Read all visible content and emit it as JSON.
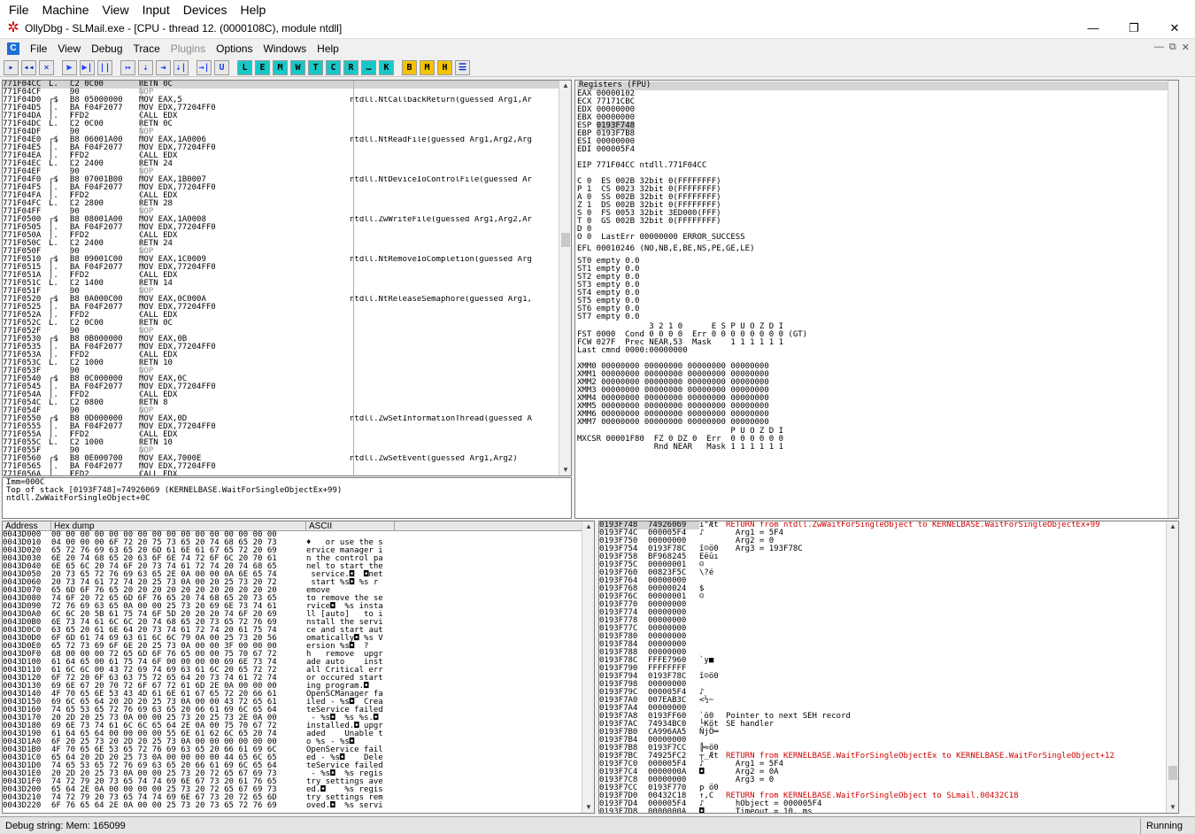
{
  "host_menu": [
    "File",
    "Machine",
    "View",
    "Input",
    "Devices",
    "Help"
  ],
  "window": {
    "title": "OllyDbg - SLMail.exe - [CPU - thread 12. (0000108C), module ntdll]",
    "minimize": "—",
    "restore": "❐",
    "close": "✕"
  },
  "menu": [
    "File",
    "View",
    "Debug",
    "Trace",
    "Plugins",
    "Options",
    "Windows",
    "Help"
  ],
  "menu_disabled": [
    "Plugins"
  ],
  "toolbar": {
    "control": [
      "▸",
      "◂◂",
      "✕",
      "▶",
      "▶|",
      "||",
      "↦",
      "⇣",
      "⇥",
      "⇣|",
      "→|",
      "U"
    ],
    "letters": [
      "L",
      "E",
      "M",
      "W",
      "T",
      "C",
      "R",
      "…",
      "K"
    ],
    "extra": [
      "B",
      "M",
      "H",
      "☰"
    ]
  },
  "disasm": [
    {
      "addr": "771F04CC",
      "br": "L.",
      "hex": "C2 0C00",
      "asm": "RETN 0C",
      "cmt": "",
      "sel": true
    },
    {
      "addr": "771F04CF",
      "br": "",
      "hex": "90",
      "asm": "NOP",
      "cmt": ""
    },
    {
      "addr": "771F04D0",
      "br": "┌$",
      "hex": "B8 05000000",
      "asm": "MOV EAX,5",
      "cmt": "ntdll.NtCallbackReturn(guessed Arg1,Ar"
    },
    {
      "addr": "771F04D5",
      "br": "│.",
      "hex": "BA F04F2077",
      "asm": "MOV EDX,77204FF0",
      "cmt": ""
    },
    {
      "addr": "771F04DA",
      "br": "│.",
      "hex": "FFD2",
      "asm": "CALL EDX",
      "cmt": ""
    },
    {
      "addr": "771F04DC",
      "br": "L.",
      "hex": "C2 0C00",
      "asm": "RETN 0C",
      "cmt": ""
    },
    {
      "addr": "771F04DF",
      "br": "",
      "hex": "90",
      "asm": "NOP",
      "cmt": ""
    },
    {
      "addr": "771F04E0",
      "br": "┌$",
      "hex": "B8 06001A00",
      "asm": "MOV EAX,1A0006",
      "cmt": "ntdll.NtReadFile(guessed Arg1,Arg2,Arg"
    },
    {
      "addr": "771F04E5",
      "br": "│.",
      "hex": "BA F04F2077",
      "asm": "MOV EDX,77204FF0",
      "cmt": ""
    },
    {
      "addr": "771F04EA",
      "br": "│.",
      "hex": "FFD2",
      "asm": "CALL EDX",
      "cmt": ""
    },
    {
      "addr": "771F04EC",
      "br": "L.",
      "hex": "C2 2400",
      "asm": "RETN 24",
      "cmt": ""
    },
    {
      "addr": "771F04EF",
      "br": "",
      "hex": "90",
      "asm": "NOP",
      "cmt": ""
    },
    {
      "addr": "771F04F0",
      "br": "┌$",
      "hex": "B8 07001B00",
      "asm": "MOV EAX,1B0007",
      "cmt": "ntdll.NtDeviceIoControlFile(guessed Ar"
    },
    {
      "addr": "771F04F5",
      "br": "│.",
      "hex": "BA F04F2077",
      "asm": "MOV EDX,77204FF0",
      "cmt": ""
    },
    {
      "addr": "771F04FA",
      "br": "│.",
      "hex": "FFD2",
      "asm": "CALL EDX",
      "cmt": ""
    },
    {
      "addr": "771F04FC",
      "br": "L.",
      "hex": "C2 2800",
      "asm": "RETN 28",
      "cmt": ""
    },
    {
      "addr": "771F04FF",
      "br": "",
      "hex": "90",
      "asm": "NOP",
      "cmt": ""
    },
    {
      "addr": "771F0500",
      "br": "┌$",
      "hex": "B8 08001A00",
      "asm": "MOV EAX,1A0008",
      "cmt": "ntdll.ZwWriteFile(guessed Arg1,Arg2,Ar"
    },
    {
      "addr": "771F0505",
      "br": "│.",
      "hex": "BA F04F2077",
      "asm": "MOV EDX,77204FF0",
      "cmt": ""
    },
    {
      "addr": "771F050A",
      "br": "│.",
      "hex": "FFD2",
      "asm": "CALL EDX",
      "cmt": ""
    },
    {
      "addr": "771F050C",
      "br": "L.",
      "hex": "C2 2400",
      "asm": "RETN 24",
      "cmt": ""
    },
    {
      "addr": "771F050F",
      "br": "",
      "hex": "90",
      "asm": "NOP",
      "cmt": ""
    },
    {
      "addr": "771F0510",
      "br": "┌$",
      "hex": "B8 09001C00",
      "asm": "MOV EAX,1C0009",
      "cmt": "ntdll.NtRemoveIoCompletion(guessed Arg"
    },
    {
      "addr": "771F0515",
      "br": "│.",
      "hex": "BA F04F2077",
      "asm": "MOV EDX,77204FF0",
      "cmt": ""
    },
    {
      "addr": "771F051A",
      "br": "│.",
      "hex": "FFD2",
      "asm": "CALL EDX",
      "cmt": ""
    },
    {
      "addr": "771F051C",
      "br": "L.",
      "hex": "C2 1400",
      "asm": "RETN 14",
      "cmt": ""
    },
    {
      "addr": "771F051F",
      "br": "",
      "hex": "90",
      "asm": "NOP",
      "cmt": ""
    },
    {
      "addr": "771F0520",
      "br": "┌$",
      "hex": "B8 0A000C00",
      "asm": "MOV EAX,0C000A",
      "cmt": "ntdll.NtReleaseSemaphore(guessed Arg1,"
    },
    {
      "addr": "771F0525",
      "br": "│.",
      "hex": "BA F04F2077",
      "asm": "MOV EDX,77204FF0",
      "cmt": ""
    },
    {
      "addr": "771F052A",
      "br": "│.",
      "hex": "FFD2",
      "asm": "CALL EDX",
      "cmt": ""
    },
    {
      "addr": "771F052C",
      "br": "L.",
      "hex": "C2 0C00",
      "asm": "RETN 0C",
      "cmt": ""
    },
    {
      "addr": "771F052F",
      "br": "",
      "hex": "90",
      "asm": "NOP",
      "cmt": ""
    },
    {
      "addr": "771F0530",
      "br": "┌$",
      "hex": "B8 0B000000",
      "asm": "MOV EAX,0B",
      "cmt": ""
    },
    {
      "addr": "771F0535",
      "br": "│.",
      "hex": "BA F04F2077",
      "asm": "MOV EDX,77204FF0",
      "cmt": ""
    },
    {
      "addr": "771F053A",
      "br": "│.",
      "hex": "FFD2",
      "asm": "CALL EDX",
      "cmt": ""
    },
    {
      "addr": "771F053C",
      "br": "L.",
      "hex": "C2 1000",
      "asm": "RETN 10",
      "cmt": ""
    },
    {
      "addr": "771F053F",
      "br": "",
      "hex": "90",
      "asm": "NOP",
      "cmt": ""
    },
    {
      "addr": "771F0540",
      "br": "┌$",
      "hex": "B8 0C000000",
      "asm": "MOV EAX,0C",
      "cmt": ""
    },
    {
      "addr": "771F0545",
      "br": "│.",
      "hex": "BA F04F2077",
      "asm": "MOV EDX,77204FF0",
      "cmt": ""
    },
    {
      "addr": "771F054A",
      "br": "│.",
      "hex": "FFD2",
      "asm": "CALL EDX",
      "cmt": ""
    },
    {
      "addr": "771F054C",
      "br": "L.",
      "hex": "C2 0800",
      "asm": "RETN 8",
      "cmt": ""
    },
    {
      "addr": "771F054F",
      "br": "",
      "hex": "90",
      "asm": "NOP",
      "cmt": ""
    },
    {
      "addr": "771F0550",
      "br": "┌$",
      "hex": "B8 0D000000",
      "asm": "MOV EAX,0D",
      "cmt": "ntdll.ZwSetInformationThread(guessed A"
    },
    {
      "addr": "771F0555",
      "br": "│.",
      "hex": "BA F04F2077",
      "asm": "MOV EDX,77204FF0",
      "cmt": ""
    },
    {
      "addr": "771F055A",
      "br": "│.",
      "hex": "FFD2",
      "asm": "CALL EDX",
      "cmt": ""
    },
    {
      "addr": "771F055C",
      "br": "L.",
      "hex": "C2 1000",
      "asm": "RETN 10",
      "cmt": ""
    },
    {
      "addr": "771F055F",
      "br": "",
      "hex": "90",
      "asm": "NOP",
      "cmt": ""
    },
    {
      "addr": "771F0560",
      "br": "┌$",
      "hex": "B8 0E000700",
      "asm": "MOV EAX,7000E",
      "cmt": "ntdll.ZwSetEvent(guessed Arg1,Arg2)"
    },
    {
      "addr": "771F0565",
      "br": "│.",
      "hex": "BA F04F2077",
      "asm": "MOV EDX,77204FF0",
      "cmt": ""
    },
    {
      "addr": "771F056A",
      "br": "│.",
      "hex": "FFD2",
      "asm": "CALL EDX",
      "cmt": ""
    }
  ],
  "info": {
    "line1": "Imm=000C",
    "line2": "Top of stack [0193F748]=74926069 (KERNELBASE.WaitForSingleObjectEx+99)",
    "line3": "",
    "line4": "",
    "line5": "ntdll.ZwWaitForSingleObject+0C"
  },
  "registers": {
    "title": "Registers (FPU)",
    "gp": [
      {
        "name": "EAX",
        "val": "00000102",
        "extra": ""
      },
      {
        "name": "ECX",
        "val": "77171CBC",
        "extra": ""
      },
      {
        "name": "EDX",
        "val": "00000000",
        "extra": ""
      },
      {
        "name": "EBX",
        "val": "00000000",
        "extra": ""
      },
      {
        "name": "ESP",
        "val": "0193F748",
        "extra": ""
      },
      {
        "name": "EBP",
        "val": "0193F7B8",
        "extra": ""
      },
      {
        "name": "ESI",
        "val": "00000000",
        "extra": ""
      },
      {
        "name": "EDI",
        "val": "000005F4",
        "extra": ""
      }
    ],
    "eip": "EIP 771F04CC ntdll.771F04CC",
    "flags": [
      "C 0  ES 002B 32bit 0(FFFFFFFF)",
      "P 1  CS 0023 32bit 0(FFFFFFFF)",
      "A 0  SS 002B 32bit 0(FFFFFFFF)",
      "Z 1  DS 002B 32bit 0(FFFFFFFF)",
      "S 0  FS 0053 32bit 3ED000(FFF)",
      "T 0  GS 002B 32bit 0(FFFFFFFF)",
      "D 0",
      "O 0  LastErr 00000000 ERROR_SUCCESS"
    ],
    "efl": "EFL 00010246 (NO,NB,E,BE,NS,PE,GE,LE)",
    "st": [
      "ST0 empty 0.0",
      "ST1 empty 0.0",
      "ST2 empty 0.0",
      "ST3 empty 0.0",
      "ST4 empty 0.0",
      "ST5 empty 0.0",
      "ST6 empty 0.0",
      "ST7 empty 0.0"
    ],
    "fpu": [
      "               3 2 1 0      E S P U O Z D I",
      "FST 0000  Cond 0 0 0 0  Err 0 0 0 0 0 0 0 0 (GT)",
      "FCW 027F  Prec NEAR,53  Mask    1 1 1 1 1 1",
      "Last cmnd 0000:00000000"
    ],
    "xmm": [
      "XMM0 00000000 00000000 00000000 00000000",
      "XMM1 00000000 00000000 00000000 00000000",
      "XMM2 00000000 00000000 00000000 00000000",
      "XMM3 00000000 00000000 00000000 00000000",
      "XMM4 00000000 00000000 00000000 00000000",
      "XMM5 00000000 00000000 00000000 00000000",
      "XMM6 00000000 00000000 00000000 00000000",
      "XMM7 00000000 00000000 00000000 00000000"
    ],
    "mxcsr": [
      "                                P U O Z D I",
      "MXCSR 00001F80  FZ 0 DZ 0  Err  0 0 0 0 0 0",
      "                Rnd NEAR   Mask 1 1 1 1 1 1"
    ]
  },
  "dump": {
    "headers": [
      "Address",
      "Hex dump",
      "ASCII"
    ],
    "rows": [
      [
        "0043D000",
        "00 00 00 00 00 00 00 00 00 00 00 00 00 00 00 00",
        "                "
      ],
      [
        "0043D010",
        "04 00 00 00 6F 72 20 75 73 65 20 74 68 65 20 73",
        "♦   or use the s"
      ],
      [
        "0043D020",
        "65 72 76 69 63 65 20 6D 61 6E 61 67 65 72 20 69",
        "ervice manager i"
      ],
      [
        "0043D030",
        "6E 20 74 68 65 20 63 6F 6E 74 72 6F 6C 20 70 61",
        "n the control pa"
      ],
      [
        "0043D040",
        "6E 65 6C 20 74 6F 20 73 74 61 72 74 20 74 68 65",
        "nel to start the"
      ],
      [
        "0043D050",
        "20 73 65 72 76 69 63 65 2E 0A 00 00 0A 6E 65 74",
        " service.◘  ◘net"
      ],
      [
        "0043D060",
        "20 73 74 61 72 74 20 25 73 0A 00 20 25 73 20 72",
        " start %s◘ %s r"
      ],
      [
        "0043D070",
        "65 6D 6F 76 65 20 20 20 20 20 20 20 20 20 20 20",
        "emove           "
      ],
      [
        "0043D080",
        "74 6F 20 72 65 6D 6F 76 65 20 74 68 65 20 73 65",
        "to remove the se"
      ],
      [
        "0043D090",
        "72 76 69 63 65 0A 00 00 25 73 20 69 6E 73 74 61",
        "rvice◘  %s insta"
      ],
      [
        "0043D0A0",
        "6C 6C 20 5B 61 75 74 6F 5D 20 20 20 74 6F 20 69",
        "ll [auto]   to i"
      ],
      [
        "0043D0B0",
        "6E 73 74 61 6C 6C 20 74 68 65 20 73 65 72 76 69",
        "nstall the servi"
      ],
      [
        "0043D0C0",
        "63 65 20 61 6E 64 20 73 74 61 72 74 20 61 75 74",
        "ce and start aut"
      ],
      [
        "0043D0D0",
        "6F 6D 61 74 69 63 61 6C 6C 79 0A 00 25 73 20 56",
        "omatically◘ %s V"
      ],
      [
        "0043D0E0",
        "65 72 73 69 6F 6E 20 25 73 0A 00 00 3F 00 00 00",
        "ersion %s◘  ?   "
      ],
      [
        "0043D0F0",
        "68 00 00 00 72 65 6D 6F 76 65 00 00 75 70 67 72",
        "h   remove  upgr"
      ],
      [
        "0043D100",
        "61 64 65 00 61 75 74 6F 00 00 00 00 69 6E 73 74",
        "ade auto    inst"
      ],
      [
        "0043D110",
        "61 6C 6C 00 43 72 69 74 69 63 61 6C 20 65 72 72",
        "all Critical err"
      ],
      [
        "0043D120",
        "6F 72 20 6F 63 63 75 72 65 64 20 73 74 61 72 74",
        "or occured start"
      ],
      [
        "0043D130",
        "69 6E 67 20 70 72 6F 67 72 61 6D 2E 0A 00 00 00",
        "ing program.◘   "
      ],
      [
        "0043D140",
        "4F 70 65 6E 53 43 4D 61 6E 61 67 65 72 20 66 61",
        "OpenSCManager fa"
      ],
      [
        "0043D150",
        "69 6C 65 64 20 2D 20 25 73 0A 00 00 43 72 65 61",
        "iled - %s◘  Crea"
      ],
      [
        "0043D160",
        "74 65 53 65 72 76 69 63 65 20 66 61 69 6C 65 64",
        "teService failed"
      ],
      [
        "0043D170",
        "20 2D 20 25 73 0A 00 00 25 73 20 25 73 2E 0A 00",
        " - %s◘  %s %s.◘ "
      ],
      [
        "0043D180",
        "69 6E 73 74 61 6C 6C 65 64 2E 0A 00 75 70 67 72",
        "installed.◘ upgr"
      ],
      [
        "0043D190",
        "61 64 65 64 00 00 00 00 55 6E 61 62 6C 65 20 74",
        "aded    Unable t"
      ],
      [
        "0043D1A0",
        "6F 20 25 73 20 2D 20 25 73 0A 00 00 00 00 00 00",
        "o %s - %s◘      "
      ],
      [
        "0043D1B0",
        "4F 70 65 6E 53 65 72 76 69 63 65 20 66 61 69 6C",
        "OpenService fail"
      ],
      [
        "0043D1C0",
        "65 64 20 2D 20 25 73 0A 00 00 00 00 44 65 6C 65",
        "ed - %s◘    Dele"
      ],
      [
        "0043D1D0",
        "74 65 53 65 72 76 69 63 65 20 66 61 69 6C 65 64",
        "teService failed"
      ],
      [
        "0043D1E0",
        "20 2D 20 25 73 0A 00 00 25 73 20 72 65 67 69 73",
        " - %s◘  %s regis"
      ],
      [
        "0043D1F0",
        "74 72 79 20 73 65 74 74 69 6E 67 73 20 61 76 65",
        "try settings ave"
      ],
      [
        "0043D200",
        "65 64 2E 0A 00 00 00 00 25 73 20 72 65 67 69 73",
        "ed.◘    %s regis"
      ],
      [
        "0043D210",
        "74 72 79 20 73 65 74 74 69 6E 67 73 20 72 65 6D",
        "try settings rem"
      ],
      [
        "0043D220",
        "6F 76 65 64 2E 0A 00 00 25 73 20 73 65 72 76 69",
        "oved.◘  %s servi"
      ]
    ]
  },
  "stack": [
    {
      "addr": "0193F748",
      "val": "74926069",
      "asc": "i\"Æt",
      "cmt": "RETURN from ntdll.ZwWaitForSingleObject to KERNELBASE.WaitForSingleObjectEx+99",
      "red": true,
      "sel": true
    },
    {
      "addr": "0193F74C",
      "val": "000005F4",
      "asc": "♪",
      "cmt": "  Arg1 = 5F4"
    },
    {
      "addr": "0193F750",
      "val": "00000000",
      "asc": "",
      "cmt": "  Arg2 = 0"
    },
    {
      "addr": "0193F754",
      "val": "0193F78C",
      "asc": "î☺ö0",
      "cmt": "  Arg3 = 193F78C"
    },
    {
      "addr": "0193F758",
      "val": "BF968245",
      "asc": "Eëûı",
      "cmt": ""
    },
    {
      "addr": "0193F75C",
      "val": "00000001",
      "asc": "☺",
      "cmt": ""
    },
    {
      "addr": "0193F760",
      "val": "00823F5C",
      "asc": "\\?é",
      "cmt": ""
    },
    {
      "addr": "0193F764",
      "val": "00000000",
      "asc": "",
      "cmt": ""
    },
    {
      "addr": "0193F768",
      "val": "00000024",
      "asc": "$",
      "cmt": ""
    },
    {
      "addr": "0193F76C",
      "val": "00000001",
      "asc": "☺",
      "cmt": ""
    },
    {
      "addr": "0193F770",
      "val": "00000000",
      "asc": "",
      "cmt": ""
    },
    {
      "addr": "0193F774",
      "val": "00000000",
      "asc": "",
      "cmt": ""
    },
    {
      "addr": "0193F778",
      "val": "00000000",
      "asc": "",
      "cmt": ""
    },
    {
      "addr": "0193F77C",
      "val": "00000000",
      "asc": "",
      "cmt": ""
    },
    {
      "addr": "0193F780",
      "val": "00000000",
      "asc": "",
      "cmt": ""
    },
    {
      "addr": "0193F784",
      "val": "00000000",
      "asc": "",
      "cmt": ""
    },
    {
      "addr": "0193F788",
      "val": "00000000",
      "asc": "",
      "cmt": ""
    },
    {
      "addr": "0193F78C",
      "val": "FFFE7960",
      "asc": "`y■",
      "cmt": ""
    },
    {
      "addr": "0193F790",
      "val": "FFFFFFFF",
      "asc": "",
      "cmt": ""
    },
    {
      "addr": "0193F794",
      "val": "0193F78C",
      "asc": "î☺ö0",
      "cmt": ""
    },
    {
      "addr": "0193F798",
      "val": "00000000",
      "asc": "",
      "cmt": ""
    },
    {
      "addr": "0193F79C",
      "val": "000005F4",
      "asc": "♪",
      "cmt": ""
    },
    {
      "addr": "0193F7A0",
      "val": "007EAB3C",
      "asc": "<½~",
      "cmt": ""
    },
    {
      "addr": "0193F7A4",
      "val": "00000000",
      "asc": "",
      "cmt": ""
    },
    {
      "addr": "0193F7A8",
      "val": "0193FF60",
      "asc": "`ö0",
      "cmt": "Pointer to next SEH record"
    },
    {
      "addr": "0193F7AC",
      "val": "74934BC0",
      "asc": "└Köt",
      "cmt": "SE handler"
    },
    {
      "addr": "0193F7B0",
      "val": "CA996AA5",
      "asc": "ÑjÖ═",
      "cmt": ""
    },
    {
      "addr": "0193F7B4",
      "val": "00000000",
      "asc": "",
      "cmt": ""
    },
    {
      "addr": "0193F7B8",
      "val": "0193F7CC",
      "asc": "╠≈ö0",
      "cmt": ""
    },
    {
      "addr": "0193F7BC",
      "val": "74925FC2",
      "asc": "┬_Æt",
      "cmt": "RETURN from KERNELBASE.WaitForSingleObjectEx to KERNELBASE.WaitForSingleObject+12",
      "red": true
    },
    {
      "addr": "0193F7C0",
      "val": "000005F4",
      "asc": "♪",
      "cmt": "  Arg1 = 5F4"
    },
    {
      "addr": "0193F7C4",
      "val": "0000000A",
      "asc": "◘",
      "cmt": "  Arg2 = 0A"
    },
    {
      "addr": "0193F7C8",
      "val": "00000000",
      "asc": "",
      "cmt": "  Arg3 = 0"
    },
    {
      "addr": "0193F7CC",
      "val": "0193F770",
      "asc": "p ö0",
      "cmt": ""
    },
    {
      "addr": "0193F7D0",
      "val": "00432C18",
      "asc": "↑,C",
      "cmt": "RETURN from KERNELBASE.WaitForSingleObject to SLmail.00432C18",
      "red": true
    },
    {
      "addr": "0193F7D4",
      "val": "000005F4",
      "asc": "♪",
      "cmt": "  hObject = 000005F4"
    },
    {
      "addr": "0193F7D8",
      "val": "0000000A",
      "asc": "◘",
      "cmt": "  Timeout = 10. ms"
    }
  ],
  "status": {
    "message": "Debug string: Mem: 165099",
    "state": "Running"
  }
}
